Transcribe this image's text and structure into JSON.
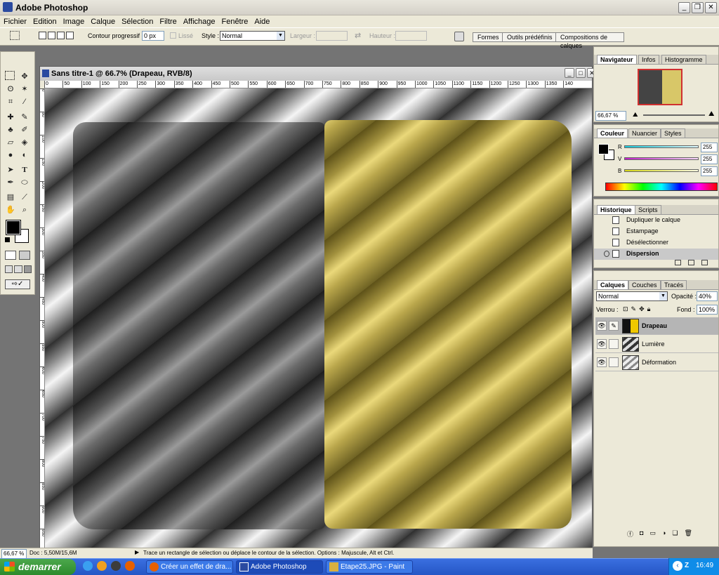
{
  "app": {
    "title": "Adobe Photoshop"
  },
  "menu": [
    "Fichier",
    "Edition",
    "Image",
    "Calque",
    "Sélection",
    "Filtre",
    "Affichage",
    "Fenêtre",
    "Aide"
  ],
  "options": {
    "feather_label": "Contour progressif :",
    "feather_value": "0 px",
    "antialias_label": "Lissé",
    "style_label": "Style :",
    "style_value": "Normal",
    "width_label": "Largeur :",
    "height_label": "Hauteur :",
    "tabs": [
      "Formes",
      "Outils prédéfinis",
      "Compositions de calques"
    ]
  },
  "document": {
    "title": "Sans titre-1 @ 66.7% (Drapeau, RVB/8)",
    "ruler_h": [
      "0",
      "50",
      "100",
      "150",
      "200",
      "250",
      "300",
      "350",
      "400",
      "450",
      "500",
      "550",
      "600",
      "650",
      "700",
      "750",
      "800",
      "850",
      "900",
      "950",
      "1000",
      "1050",
      "1100",
      "1150",
      "1200",
      "1250",
      "1300",
      "1350",
      "140"
    ],
    "ruler_v": [
      "0",
      "50",
      "100",
      "150",
      "200",
      "250",
      "300",
      "350",
      "400",
      "450",
      "500",
      "550",
      "600",
      "650",
      "700",
      "750",
      "800",
      "850",
      "900",
      "950"
    ]
  },
  "status": {
    "zoom": "66,67 %",
    "doc": "Doc : 5,50M/15,6M",
    "hint": "Trace un rectangle de sélection ou déplace le contour de la sélection. Options : Majuscule, Alt et Ctrl."
  },
  "navigator": {
    "tabs": [
      "Navigateur",
      "Infos",
      "Histogramme"
    ],
    "zoom": "66,67 %"
  },
  "color": {
    "tabs": [
      "Couleur",
      "Nuancier",
      "Styles"
    ],
    "channels": [
      {
        "label": "R",
        "value": "255",
        "color": "#19c8d8"
      },
      {
        "label": "V",
        "value": "255",
        "color": "#c020c8"
      },
      {
        "label": "B",
        "value": "255",
        "color": "#d8d818"
      }
    ]
  },
  "history": {
    "tabs": [
      "Historique",
      "Scripts"
    ],
    "items": [
      "Dupliquer le calque",
      "Estampage",
      "Désélectionner",
      "Dispersion"
    ]
  },
  "layers": {
    "tabs": [
      "Calques",
      "Couches",
      "Tracés"
    ],
    "blend_mode": "Normal",
    "opacity_label": "Opacité :",
    "opacity_value": "40%",
    "lock_label": "Verrou :",
    "fill_label": "Fond :",
    "fill_value": "100%",
    "items": [
      "Drapeau",
      "Lumière",
      "Déformation"
    ]
  },
  "taskbar": {
    "start": "demarrer",
    "tasks": [
      "Créer un effet de dra...",
      "Adobe Photoshop",
      "Etape25.JPG - Paint"
    ],
    "clock": "16:49"
  }
}
